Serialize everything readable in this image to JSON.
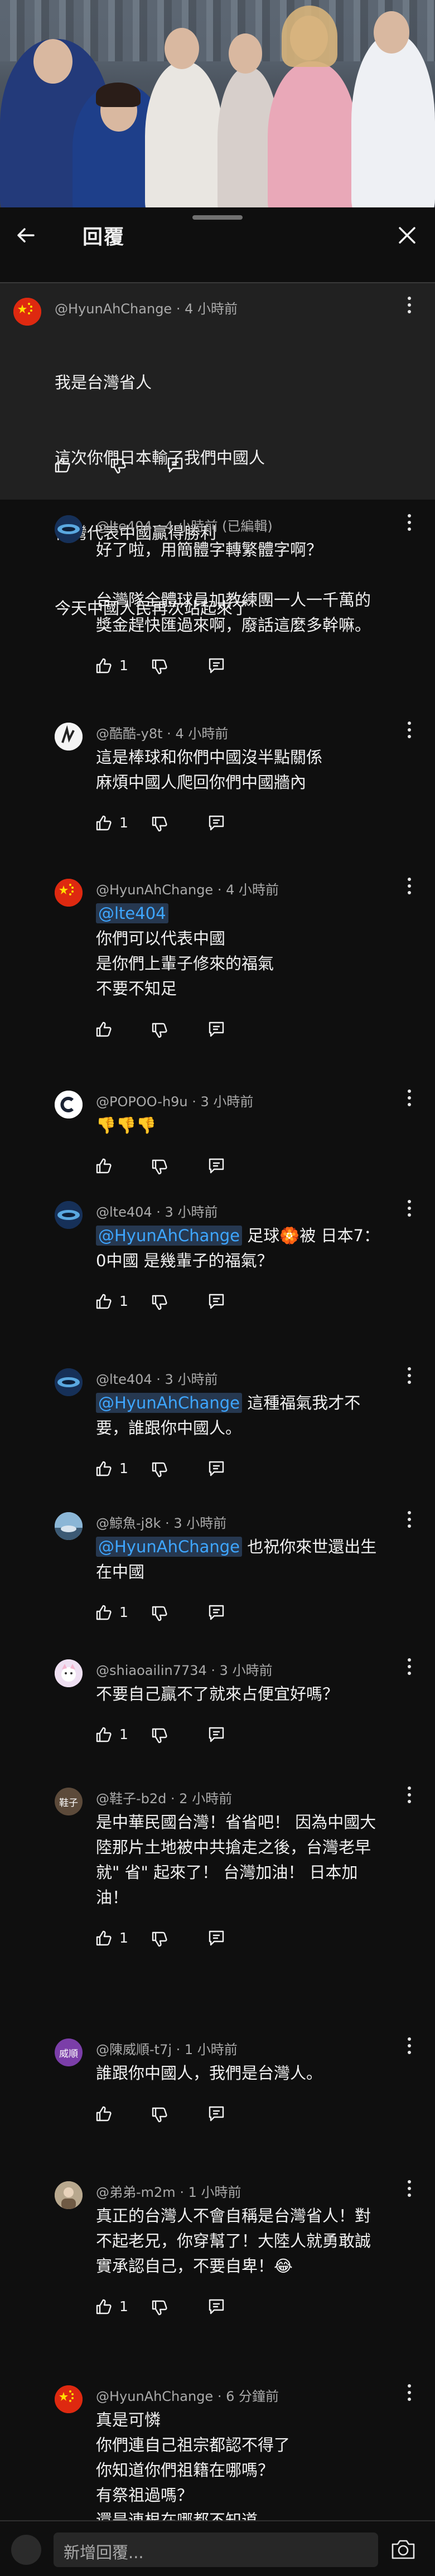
{
  "header": {
    "title": "回覆",
    "back_icon": "arrow-left-icon",
    "close_icon": "close-icon"
  },
  "parent": {
    "author": "@HyunAhChange",
    "time": "4 小時前",
    "lines": [
      "我是台灣省人",
      "這次你們日本輸了我們中國人",
      "台灣代表中國贏得勝利",
      "今天中國人民再次站起來了"
    ],
    "avatar_icon": "china-flag-icon"
  },
  "replies": [
    {
      "author": "@lte404",
      "time": "4 小時前 (已編輯)",
      "lines": [
        "好了啦，用簡體字轉繁體字啊？",
        "",
        "台灣隊全體球員加教練團一人一千萬的",
        "獎金趕快匯過來啊，廢話這麼多幹嘛。"
      ],
      "likes": "1"
    },
    {
      "author": "@酷酷-y8t",
      "time": "4 小時前",
      "lines": [
        "這是棒球和你們中國沒半點關係",
        "麻煩中國人爬回你們中國牆內"
      ],
      "likes": "1"
    },
    {
      "author": "@HyunAhChange",
      "time": "4 小時前",
      "mention": "@lte404",
      "lines": [
        "你們可以代表中國",
        "是你們上輩子修來的福氣",
        "不要不知足"
      ],
      "likes": ""
    },
    {
      "author": "@POPOO-h9u",
      "time": "3 小時前",
      "lines": [
        "👎👎👎"
      ],
      "likes": ""
    },
    {
      "author": "@lte404",
      "time": "3 小時前",
      "mention": "@HyunAhChange",
      "inline": "足球🏵️被 日本7：",
      "lines": [
        "0中國 是幾輩子的福氣？"
      ],
      "likes": "1"
    },
    {
      "author": "@lte404",
      "time": "3 小時前",
      "mention": "@HyunAhChange",
      "inline": "這種福氣我才不",
      "lines": [
        "要，誰跟你中國人。"
      ],
      "likes": "1"
    },
    {
      "author": "@鯨魚-j8k",
      "time": "3 小時前",
      "mention": "@HyunAhChange",
      "inline": "也祝你來世還出生",
      "lines": [
        "在中國"
      ],
      "likes": "1"
    },
    {
      "author": "@shiaoailin7734",
      "time": "3 小時前",
      "lines": [
        "不要自己贏不了就來占便宜好嗎？"
      ],
      "likes": "1"
    },
    {
      "author": "@鞋子-b2d",
      "time": "2 小時前",
      "lines": [
        "是中華民國台灣！省省吧！ 因為中國大",
        "陸那片土地被中共搶走之後，台灣老早",
        "就\" 省\" 起來了！ 台灣加油！ 日本加",
        "油！"
      ],
      "likes": "1",
      "avatar_text": "鞋子"
    },
    {
      "author": "@陳威順-t7j",
      "time": "1 小時前",
      "lines": [
        "誰跟你中國人，我們是台灣人。"
      ],
      "likes": "",
      "avatar_text": "威順"
    },
    {
      "author": "@弟弟-m2m",
      "time": "1 小時前",
      "lines": [
        "真正的台灣人不會自稱是台灣省人！對",
        "不起老兄，你穿幫了！大陸人就勇敢誠",
        "實承認自己，不要自卑！😂"
      ],
      "likes": "1"
    },
    {
      "author": "@HyunAhChange",
      "time": "6 分鐘前",
      "lines": [
        "真是可憐",
        "你們連自己祖宗都認不得了",
        "你知道你們祖籍在哪嗎？",
        "有祭祖過嗎？",
        "還是連根在哪都不知道"
      ],
      "likes": ""
    }
  ],
  "footer": {
    "placeholder": "新增回覆...",
    "camera_icon": "camera-icon"
  },
  "colors": {
    "background": "#0f0f0f",
    "parent_bg": "#212121",
    "mention_text": "#3ea6ff",
    "mention_bg": "#263850"
  }
}
